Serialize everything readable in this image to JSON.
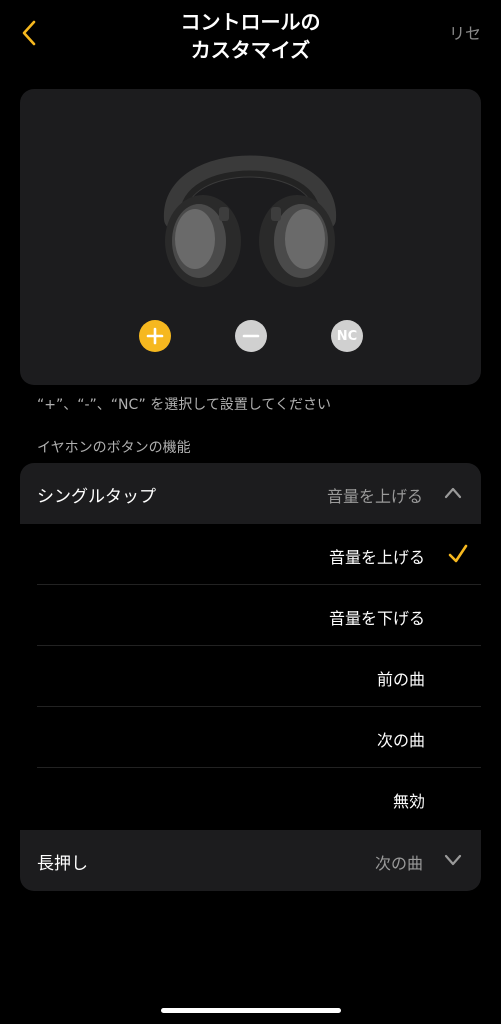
{
  "header": {
    "title_line1": "コントロールの",
    "title_line2": "カスタマイズ",
    "reset_label": "リセ"
  },
  "device": {
    "buttons": {
      "plus": "+",
      "minus": "−",
      "nc": "NC"
    }
  },
  "hint": "“+”、“-”、“NC” を選択して設置してください",
  "section_label": "イヤホンのボタンの機能",
  "single_tap": {
    "label": "シングルタップ",
    "value": "音量を上げる",
    "options": [
      {
        "label": "音量を上げる",
        "selected": true
      },
      {
        "label": "音量を下げる",
        "selected": false
      },
      {
        "label": "前の曲",
        "selected": false
      },
      {
        "label": "次の曲",
        "selected": false
      },
      {
        "label": "無効",
        "selected": false
      }
    ]
  },
  "long_press": {
    "label": "長押し",
    "value": "次の曲"
  },
  "colors": {
    "accent": "#f6b81f",
    "card": "#1c1c1e",
    "background": "#000000"
  }
}
